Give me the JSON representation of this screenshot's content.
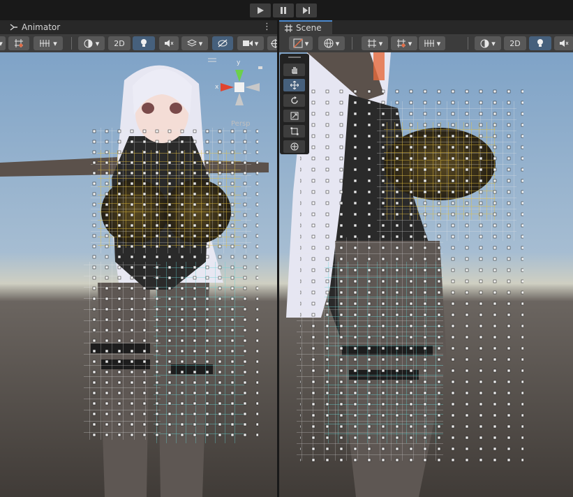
{
  "playbar": {
    "buttons": [
      {
        "name": "play-button",
        "glyph": "▶"
      },
      {
        "name": "pause-button",
        "glyph": "❚❚"
      },
      {
        "name": "step-button",
        "glyph": "▶❙"
      }
    ]
  },
  "left_panel": {
    "tab_label": "Animator",
    "tab_icon": "animator-icon",
    "menu_glyph": "⋮",
    "toolbar": {
      "label_2d": "2D"
    },
    "gizmo": {
      "x_label": "x",
      "y_label": "y",
      "persp_label": "Persp"
    }
  },
  "right_panel": {
    "tab_label": "Scene",
    "tab_icon": "scene-icon",
    "toolbar": {
      "label_2d": "2D"
    },
    "tools": [
      "hand-tool-icon",
      "move-tool-icon",
      "rotate-tool-icon",
      "scale-tool-icon",
      "rect-tool-icon",
      "transform-tool-icon"
    ]
  },
  "colors": {
    "sky": "#8fb2d4",
    "horizon": "#c7c7b9",
    "ground": "#4a4541",
    "cloth_cage": "#5fd6d6",
    "chest_cage": "#e8c23c",
    "white_cage": "#ffffff",
    "hair": "#e9e9f4"
  }
}
